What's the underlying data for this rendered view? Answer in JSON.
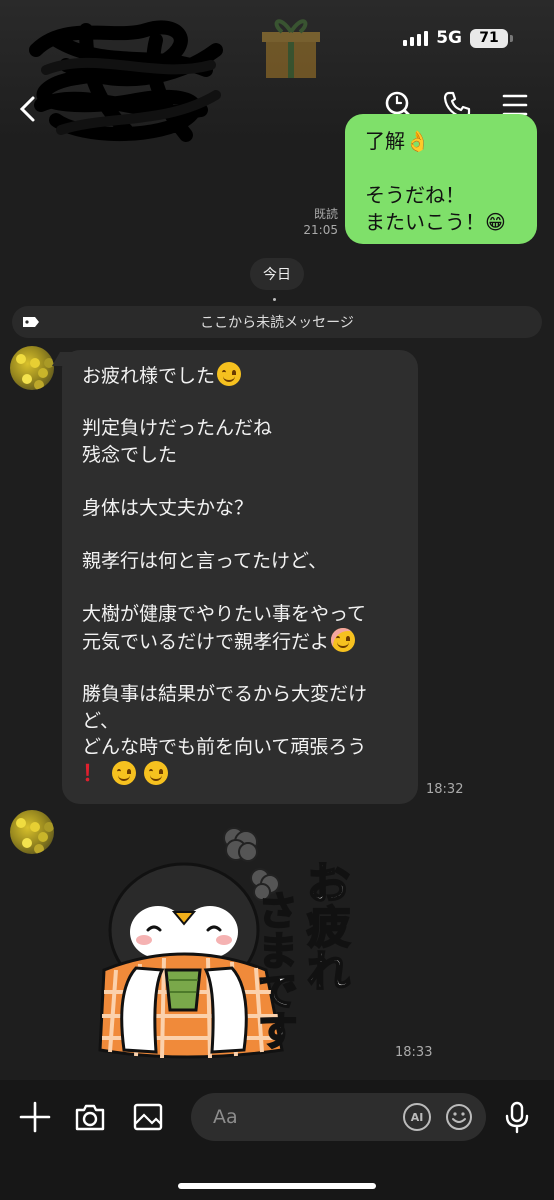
{
  "status_bar": {
    "network": "5G",
    "battery": "71"
  },
  "header": {
    "back_icon": "chevron-left-icon",
    "icons": [
      "search-icon",
      "phone-icon",
      "menu-icon"
    ]
  },
  "messages": {
    "sent": {
      "text": "了解👌\n\nそうだね！\nまたいこう！😁",
      "read_label": "既読",
      "time": "21:05"
    },
    "date_label": "今日",
    "unread_label": "ここから未読メッセージ",
    "received": {
      "lines": [
        "お疲れ様でした",
        "",
        "判定負けだったんだね",
        "残念でした",
        "",
        "身体は大丈夫かな？",
        "",
        "親孝行は何と言ってたけど、",
        "",
        "大樹が健康でやりたい事をやって",
        "元気でいるだけで親孝行だよ",
        "",
        "勝負事は結果がでるから大変だけ",
        "ど、",
        "どんな時でも前を向いて頑張ろう",
        "！"
      ],
      "time": "18:32"
    },
    "sticker": {
      "text_line1": "お疲れ",
      "text_line2": "さまです",
      "time": "18:33"
    }
  },
  "input_bar": {
    "placeholder": "Aa",
    "ai_label": "AI",
    "icons": [
      "plus-icon",
      "camera-icon",
      "image-icon",
      "emoji-icon",
      "microphone-icon"
    ]
  },
  "colors": {
    "sent_bubble": "#7fe06a",
    "received_bubble": "#2e2e2e",
    "background": "#1e1e1e"
  }
}
